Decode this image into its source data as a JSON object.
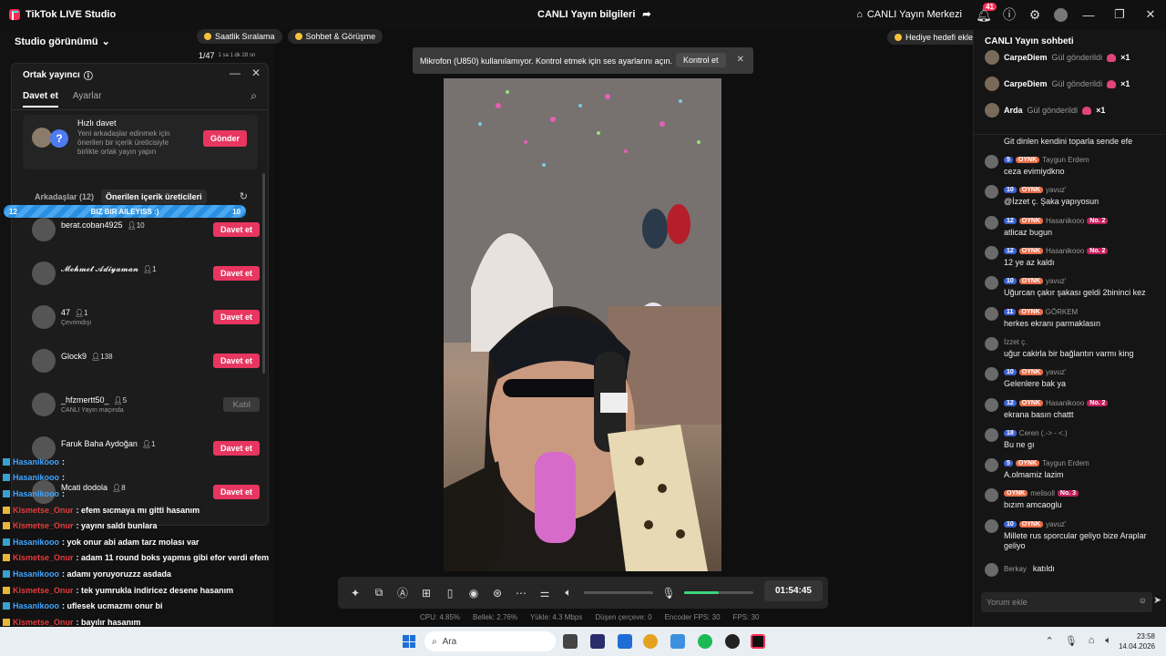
{
  "titlebar": {
    "app_title": "TikTok LIVE Studio",
    "center_title": "CANLI Yayın bilgileri",
    "live_center": "CANLI Yayın Merkezi",
    "notif_count": "41"
  },
  "studio": {
    "view_label": "Studio görünümü",
    "pills": [
      "Saatlik Sıralama",
      "Sohbet & Görüşme"
    ],
    "mini_count": "1/47",
    "mini_sub": "1 sa 1 dk 28 sn"
  },
  "cohost": {
    "title": "Ortak yayıncı",
    "tabs": [
      "Davet et",
      "Ayarlar"
    ],
    "quick": {
      "title": "Hızlı davet",
      "desc": "Yeni arkadaşlar edinmek için önerilen bir içerik üreticisiyle birlikte ortak yayın yapın",
      "button": "Gönder"
    },
    "filter_friends": "Arkadaşlar (12)",
    "filter_suggested": "Önerilen içerik üreticileri",
    "streak": {
      "left": "12",
      "label": "BIZ BIR AILEYISS :)",
      "right": "10"
    },
    "rows": [
      {
        "name": "berat.coban4925",
        "followers": "10",
        "sub": "",
        "action": "Davet et"
      },
      {
        "name": "𝓜𝓮𝓱𝓶𝓮𝓽 𝓐𝓭𝓲𝔂𝓪𝓶𝓪𝓷",
        "followers": "1",
        "sub": "",
        "action": "Davet et"
      },
      {
        "name": "47",
        "followers": "1",
        "sub": "Çevrimdışı",
        "action": "Davet et"
      },
      {
        "name": "Glock9",
        "followers": "138",
        "sub": "",
        "action": "Davet et"
      },
      {
        "name": "_hfzmertt50_",
        "followers": "5",
        "sub": "CANLI Yayın maçında",
        "action": "Katıl"
      },
      {
        "name": "Faruk Baha Aydoğan",
        "followers": "1",
        "sub": "",
        "action": "Davet et"
      },
      {
        "name": "Mcati dodola",
        "followers": "8",
        "sub": "",
        "action": "Davet et"
      }
    ]
  },
  "overlay_chat": [
    {
      "user": "Hasanikooo",
      "text": ":",
      "color": "blue"
    },
    {
      "user": "Hasanikooo",
      "text": ":",
      "color": "blue"
    },
    {
      "user": "Hasanikooo",
      "text": ":",
      "color": "blue"
    },
    {
      "user": "Kismetse_Onur",
      "text": ": efem sıcmaya mı gitti hasanım",
      "color": "red"
    },
    {
      "user": "Kismetse_Onur",
      "text": ": yayını saldı bunlara",
      "color": "red"
    },
    {
      "user": "Hasanikooo",
      "text": ": yok onur abi adam tarz molası var",
      "color": "blue"
    },
    {
      "user": "Kismetse_Onur",
      "text": ": adam 11 round boks yapmıs gibi efor verdi efem",
      "color": "red"
    },
    {
      "user": "Hasanikooo",
      "text": ": adamı yoruyoruzzz asdada",
      "color": "blue"
    },
    {
      "user": "Kismetse_Onur",
      "text": ": tek yumrukla indiricez desene hasanım",
      "color": "red"
    },
    {
      "user": "Hasanikooo",
      "text": ": uflesek ucmazmı onur bi",
      "color": "blue"
    },
    {
      "user": "Kismetse_Onur",
      "text": ": bayılır hasanım",
      "color": "red"
    }
  ],
  "banner": {
    "text": "Mikrofon (U850) kullanılamıyor. Kontrol etmek için ses ayarlarını açın.",
    "button": "Kontrol et"
  },
  "gift_goal": "Hediye hedefi ekle",
  "controls": {
    "timer": "01:54:45",
    "mic_level": 0.5
  },
  "stats": [
    "CPU: 4.85%",
    "Bellek: 2.76%",
    "Yükle: 4.3 Mbps",
    "Düşen çerçeve: 0",
    "Encoder FPS: 30",
    "FPS: 30"
  ],
  "chat": {
    "title": "CANLI Yayın sohbeti",
    "gifts": [
      {
        "user": "CarpeDiem",
        "text": "Gül gönderildi",
        "count": "×1"
      },
      {
        "user": "CarpeDiem",
        "text": "Gül gönderildi",
        "count": "×1"
      },
      {
        "user": "Arda",
        "text": "Gül gönderildi",
        "count": "×1"
      }
    ],
    "messages": [
      {
        "lv": "",
        "fan": "",
        "user": "",
        "rank": "",
        "text": "Git dinlen kendini toparla sende efe"
      },
      {
        "lv": "5",
        "fan": "OYNK",
        "user": "Taygun Erdem",
        "rank": "",
        "text": "ceza evimiydkno"
      },
      {
        "lv": "10",
        "fan": "OYNK",
        "user": "yavuz'",
        "rank": "",
        "text": "@İzzet ç. Şaka yapıyosun"
      },
      {
        "lv": "12",
        "fan": "OYNK",
        "user": "Hasanikooo",
        "rank": "No. 2",
        "text": "atlicaz bugun"
      },
      {
        "lv": "12",
        "fan": "OYNK",
        "user": "Hasanikooo",
        "rank": "No. 2",
        "text": "12 ye az kaldı"
      },
      {
        "lv": "10",
        "fan": "OYNK",
        "user": "yavuz'",
        "rank": "",
        "text": "Uğurcan çakır şakası geldi 2bininci kez"
      },
      {
        "lv": "11",
        "fan": "OYNK",
        "user": "GÖRKEM",
        "rank": "",
        "text": "herkes ekranı parmaklasın"
      },
      {
        "lv": "",
        "fan": "",
        "user": "İzzet ç.",
        "rank": "",
        "text": "uğur cakirla bir bağlantın varmı king"
      },
      {
        "lv": "10",
        "fan": "OYNK",
        "user": "yavuz'",
        "rank": "",
        "text": "Gelenlere bak ya"
      },
      {
        "lv": "12",
        "fan": "OYNK",
        "user": "Hasanikooo",
        "rank": "No. 2",
        "text": "ekrana basın chattt"
      },
      {
        "lv": "18",
        "fan": "",
        "user": "Ceren (.-> - <.)",
        "rank": "",
        "text": "Bu ne gı"
      },
      {
        "lv": "5",
        "fan": "OYNK",
        "user": "Taygun Erdem",
        "rank": "",
        "text": "A.olmamiz lazim"
      },
      {
        "lv": "",
        "fan": "OYNK",
        "user": "melisoll",
        "rank": "No. 3",
        "text": "bızım amcaoglu"
      },
      {
        "lv": "10",
        "fan": "OYNK",
        "user": "yavuz'",
        "rank": "",
        "text": "Millete rus sporcular geliyo bize Araplar geliyo"
      },
      {
        "lv": "",
        "fan": "",
        "user": "Berkay",
        "rank": "",
        "text": "katıldı"
      }
    ],
    "comment_placeholder": "Yorum ekle"
  },
  "taskbar": {
    "search": "Ara",
    "time": "23:58",
    "date": "14.04.2026"
  }
}
